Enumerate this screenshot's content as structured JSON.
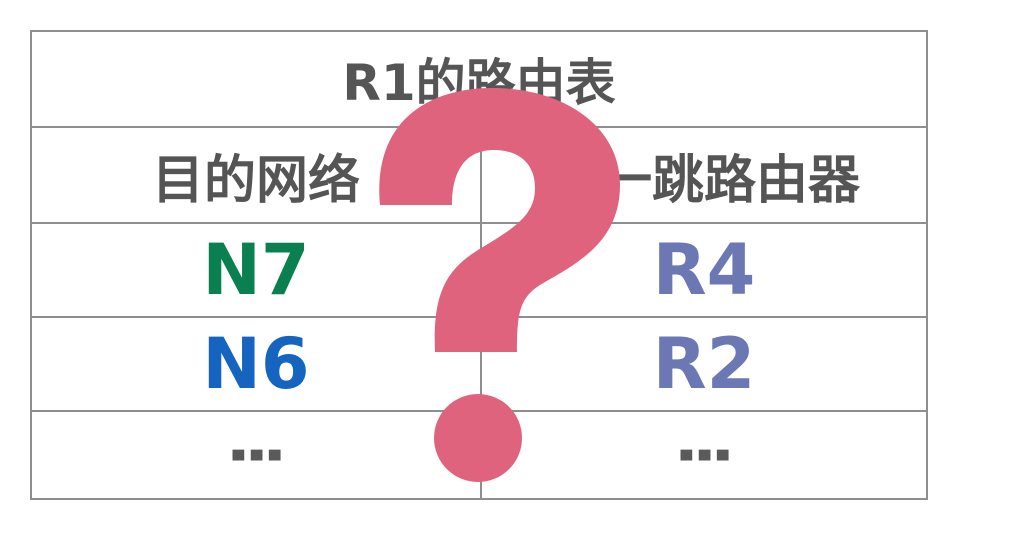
{
  "table": {
    "title": "R1的路由表",
    "headers": {
      "destination": "目的网络",
      "next_hop": "下一跳路由器"
    },
    "rows": [
      {
        "destination": "N7",
        "next_hop": "R4",
        "destination_color": "#0a8050"
      },
      {
        "destination": "N6",
        "next_hop": "R2",
        "destination_color": "#1565c0"
      },
      {
        "destination": "⋮",
        "next_hop": "⋮"
      }
    ],
    "colors": {
      "border": "#8e8e8e",
      "header_text": "#555555",
      "next_hop_text": "#6b78b4"
    }
  },
  "overlay": {
    "icon": "question-mark-icon",
    "color": "#e0637e"
  }
}
